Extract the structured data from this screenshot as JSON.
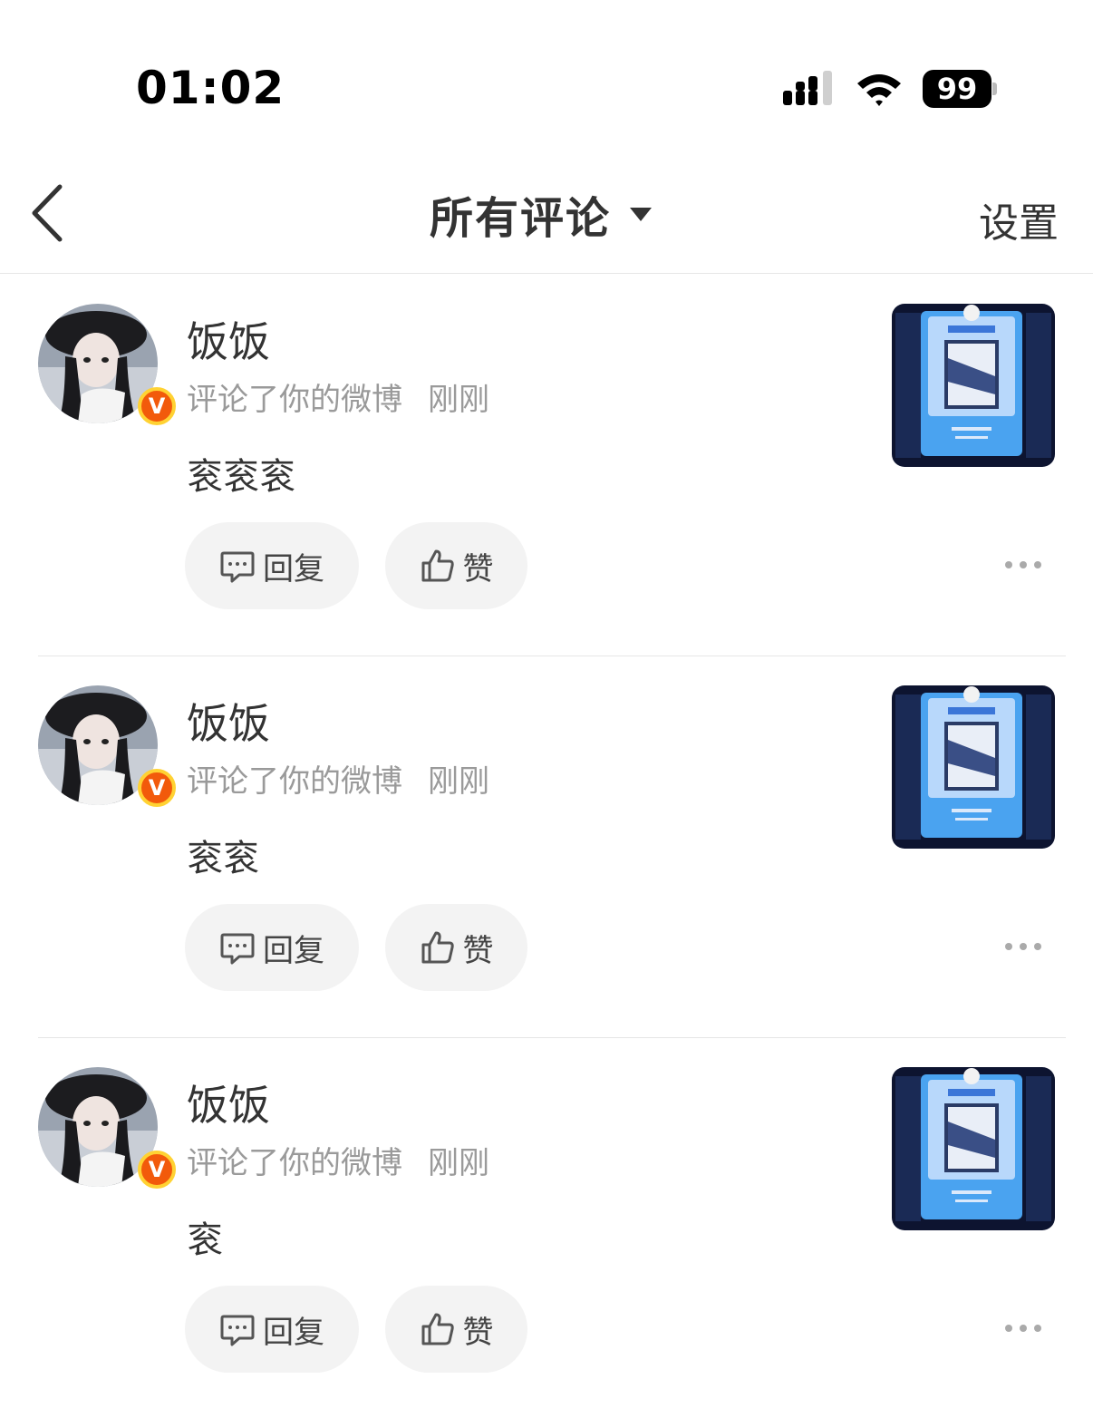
{
  "status_bar": {
    "time": "01:02",
    "battery": "99",
    "icons": [
      "signal-icon",
      "wifi-icon",
      "battery-icon"
    ]
  },
  "nav": {
    "back_icon": "chevron-left-icon",
    "title": "所有评论",
    "dropdown_icon": "caret-down-icon",
    "settings_label": "设置"
  },
  "comments": [
    {
      "user_name": "饭饭",
      "badge": "V",
      "action_text": "评论了你的微博",
      "time": "刚刚",
      "text": "衮衮衮",
      "reply_label": "回复",
      "like_label": "赞"
    },
    {
      "user_name": "饭饭",
      "badge": "V",
      "action_text": "评论了你的微博",
      "time": "刚刚",
      "text": "衮衮",
      "reply_label": "回复",
      "like_label": "赞"
    },
    {
      "user_name": "饭饭",
      "badge": "V",
      "action_text": "评论了你的微博",
      "time": "刚刚",
      "text": "衮",
      "reply_label": "回复",
      "like_label": "赞"
    }
  ],
  "colors": {
    "badge": "#f25a0b",
    "badge_border": "#ffd233",
    "muted_text": "#9a9a9a",
    "button_bg": "#f3f3f3"
  }
}
